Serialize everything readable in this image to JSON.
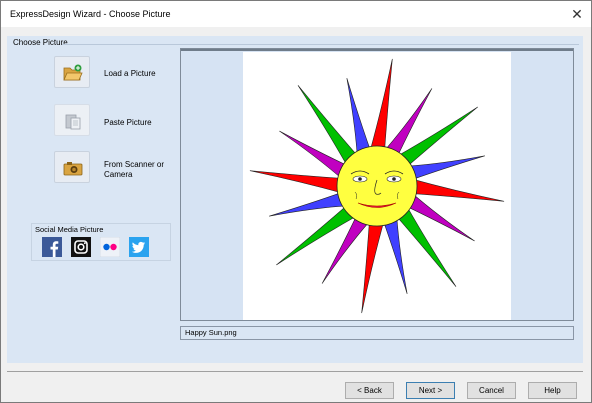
{
  "window": {
    "title": "ExpressDesign Wizard - Choose Picture",
    "close_glyph": "✕"
  },
  "group": {
    "label": "Choose Picture"
  },
  "actions": [
    {
      "label": "Load a Picture",
      "icon": "folder-open-icon"
    },
    {
      "label": "Paste Picture",
      "icon": "paste-icon"
    },
    {
      "label": "From Scanner or Camera",
      "icon": "camera-icon"
    }
  ],
  "social": {
    "label": "Social Media Picture",
    "icons": [
      "facebook-icon",
      "instagram-icon",
      "flickr-icon",
      "twitter-icon"
    ]
  },
  "preview": {
    "filename": "Happy Sun.png"
  },
  "buttons": {
    "back": "< Back",
    "next": "Next >",
    "cancel": "Cancel",
    "help": "Help"
  },
  "colors": {
    "panel": "#dae6f4",
    "ray_red": "#ff0000",
    "ray_green": "#00c000",
    "ray_blue": "#4040ff",
    "ray_purple": "#c000c0",
    "sun_face": "#ffff40"
  }
}
